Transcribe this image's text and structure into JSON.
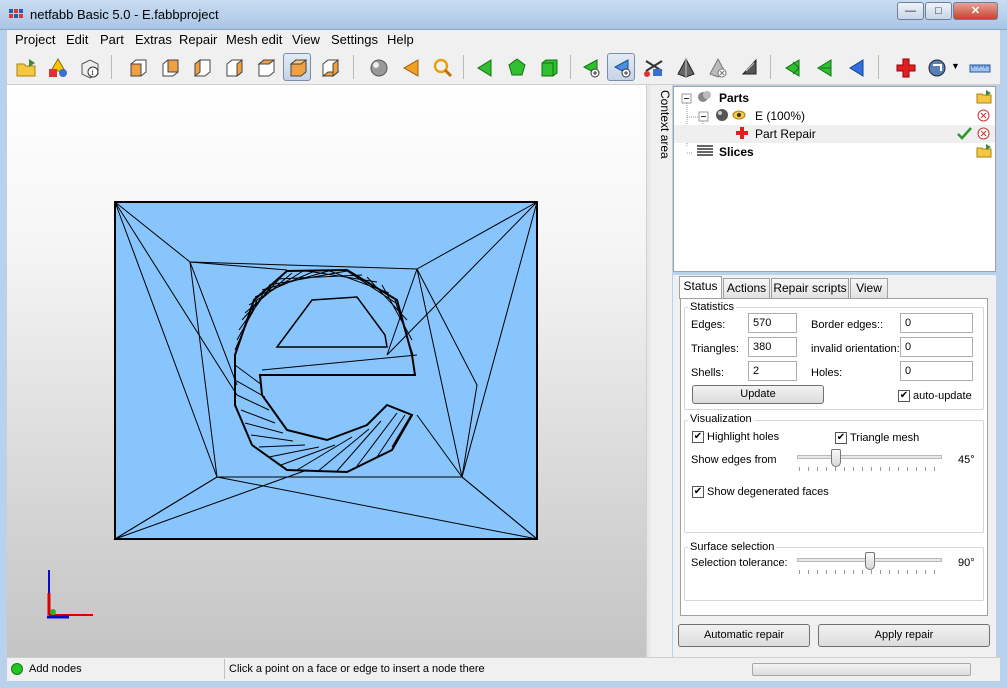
{
  "window": {
    "title": "netfabb Basic 5.0 - E.fabbproject",
    "minimize": "—",
    "maximize": "□",
    "close": "✕"
  },
  "menu": [
    "Project",
    "Edit",
    "Part",
    "Extras",
    "Repair",
    "Mesh edit",
    "View",
    "Settings",
    "Help"
  ],
  "context_area_label": "Context area",
  "tree": {
    "parts_label": "Parts",
    "part_label": "E (100%)",
    "repair_label": "Part Repair",
    "slices_label": "Slices"
  },
  "tabs": [
    "Status",
    "Actions",
    "Repair scripts",
    "View"
  ],
  "statistics": {
    "title": "Statistics",
    "edges_label": "Edges:",
    "edges": "570",
    "triangles_label": "Triangles:",
    "triangles": "380",
    "shells_label": "Shells:",
    "shells": "2",
    "border_edges_label": "Border edges::",
    "border_edges": "0",
    "invalid_orientation_label": "invalid orientation:",
    "invalid_orientation": "0",
    "holes_label": "Holes:",
    "holes": "0",
    "update_button": "Update",
    "auto_update_label": "auto-update",
    "auto_update": true
  },
  "visualization": {
    "title": "Visualization",
    "highlight_holes_label": "Highlight holes",
    "highlight_holes": true,
    "triangle_mesh_label": "Triangle mesh",
    "triangle_mesh": true,
    "show_edges_label": "Show edges from",
    "show_edges_value": "45°",
    "show_edges_fraction": 0.25,
    "show_degenerated_label": "Show degenerated faces",
    "show_degenerated": true
  },
  "surface_selection": {
    "title": "Surface selection",
    "tolerance_label": "Selection tolerance:",
    "tolerance_value": "90°",
    "tolerance_fraction": 0.5
  },
  "buttons": {
    "automatic_repair": "Automatic repair",
    "apply_repair": "Apply repair"
  },
  "status": {
    "mode": "Add nodes",
    "hint": "Click a point on a face or edge to insert a node there"
  },
  "colors": {
    "mesh_fill": "#87c5fc",
    "mesh_line": "#000000",
    "status_light": "#22c522"
  }
}
